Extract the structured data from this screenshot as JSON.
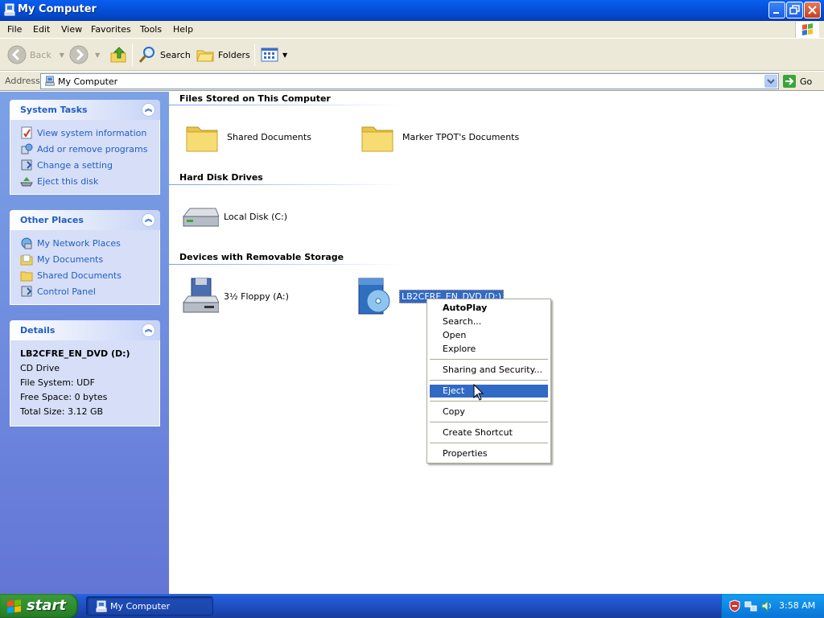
{
  "window": {
    "title": "My Computer",
    "buttons": {
      "minimize": "",
      "maximize": "",
      "close": ""
    }
  },
  "menu": [
    "File",
    "Edit",
    "View",
    "Favorites",
    "Tools",
    "Help"
  ],
  "toolbar": {
    "back": "Back",
    "search": "Search",
    "folders": "Folders"
  },
  "address": {
    "label": "Address",
    "value": "My Computer",
    "go": "Go"
  },
  "left_pane": {
    "system_tasks": {
      "title": "System Tasks",
      "items": [
        "View system information",
        "Add or remove programs",
        "Change a setting",
        "Eject this disk"
      ]
    },
    "other_places": {
      "title": "Other Places",
      "items": [
        "My Network Places",
        "My Documents",
        "Shared Documents",
        "Control Panel"
      ]
    },
    "details": {
      "title": "Details",
      "name": "LB2CFRE_EN_DVD (D:)",
      "type": "CD Drive",
      "file_system": "File System: UDF",
      "free_space": "Free Space: 0 bytes",
      "total_size": "Total Size: 3.12 GB"
    }
  },
  "content": {
    "groups": [
      {
        "title": "Files Stored on This Computer",
        "items": [
          "Shared Documents",
          "Marker TPOT's Documents"
        ]
      },
      {
        "title": "Hard Disk Drives",
        "items": [
          "Local Disk (C:)"
        ]
      },
      {
        "title": "Devices with Removable Storage",
        "items": [
          "3½ Floppy (A:)",
          "LB2CFRE_EN_DVD (D:)"
        ]
      }
    ]
  },
  "context_menu": {
    "items": [
      "AutoPlay",
      "Search...",
      "Open",
      "Explore",
      "Sharing and Security...",
      "Eject",
      "Copy",
      "Create Shortcut",
      "Properties"
    ],
    "highlighted": "Eject",
    "default": "AutoPlay"
  },
  "taskbar": {
    "start": "start",
    "task": "My Computer",
    "clock": "3:58 AM"
  },
  "colors": {
    "title_blue": "#0453dc",
    "pane_blue": "#6375d6",
    "link_blue": "#215dc6",
    "highlight": "#316ac5",
    "start_green": "#2f8f2f"
  }
}
